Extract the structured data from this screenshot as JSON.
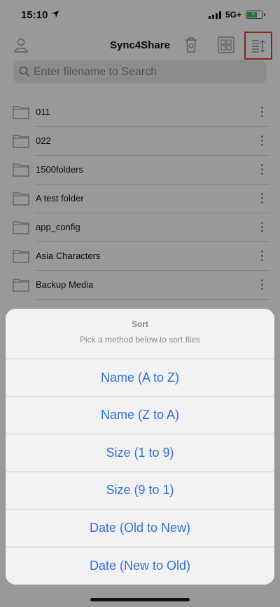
{
  "status": {
    "time": "15:10",
    "network": "5G+"
  },
  "nav": {
    "title": "Sync4Share"
  },
  "search": {
    "placeholder": "Enter filename to Search"
  },
  "files": [
    {
      "name": "011"
    },
    {
      "name": "022"
    },
    {
      "name": "1500folders"
    },
    {
      "name": "A test folder"
    },
    {
      "name": "app_config"
    },
    {
      "name": "Asia Characters"
    },
    {
      "name": "Backup Media"
    }
  ],
  "sheet": {
    "title": "Sort",
    "message": "Pick a method below to sort files",
    "options": [
      {
        "label": "Name (A to Z)"
      },
      {
        "label": "Name (Z to A)"
      },
      {
        "label": "Size (1 to 9)"
      },
      {
        "label": "Size (9 to 1)"
      },
      {
        "label": "Date (Old to New)"
      },
      {
        "label": "Date (New to Old)"
      }
    ]
  },
  "icons": {
    "nav": [
      "user-icon",
      "trash-icon",
      "grid-view-icon",
      "sort-icon"
    ],
    "row": [
      "folder-icon",
      "more-vertical-icon"
    ],
    "status": [
      "location-arrow-icon",
      "signal-icon",
      "battery-charging-icon"
    ]
  },
  "colors": {
    "accent": "#2f6fdc",
    "highlight": "#e53a2a",
    "battery": "#34c759"
  }
}
